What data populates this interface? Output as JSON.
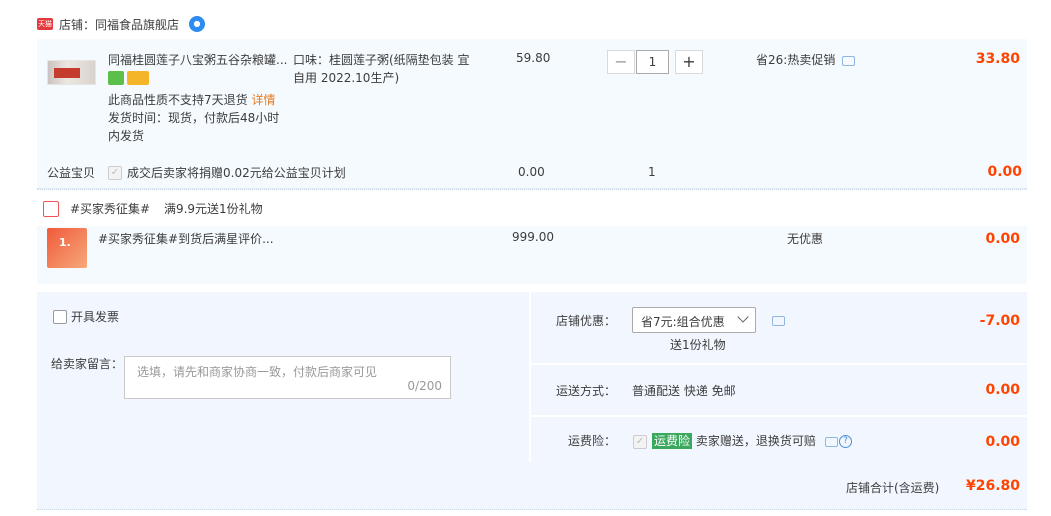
{
  "shop": {
    "tmall_text": "天猫",
    "label": "店铺：同福食品旗舰店",
    "ww_badge": "●"
  },
  "item1": {
    "title": "同福桂圆莲子八宝粥五谷杂粮罐...",
    "refund_note": "此商品性质不支持7天退货",
    "refund_link": "详情",
    "ship_line1": "发货时间：现货，付款后48小时",
    "ship_line2": "内发货",
    "spec_line1": "口味：桂圆莲子粥(纸隔垫包装 宜",
    "spec_line2": "自用 2022.10生产)",
    "price": "59.80",
    "qty": "1",
    "discount": "省26:热卖促销",
    "total": "33.80"
  },
  "charity": {
    "label": "公益宝贝",
    "text": "成交后卖家将捐赠0.02元给公益宝贝计划",
    "price": "0.00",
    "qty": "1",
    "total": "0.00"
  },
  "gift": {
    "tag": "#买家秀征集#",
    "promo": "满9.9元送1份礼物",
    "item_title": "#买家秀征集#到货后满星评价...",
    "item_thumb_text": "1.",
    "price": "999.00",
    "discount": "无优惠",
    "total": "0.00"
  },
  "invoice": {
    "label": "开具发票"
  },
  "message": {
    "label": "给卖家留言：",
    "placeholder": "选填，请先和商家协商一致，付款后商家可见",
    "count": "0/200"
  },
  "shop_discount": {
    "label": "店铺优惠：",
    "selected": "省7元:组合优惠",
    "sub": "送1份礼物",
    "total": "-7.00"
  },
  "shipping": {
    "label": "运送方式：",
    "value": "普通配送 快递 免邮",
    "total": "0.00"
  },
  "insurance": {
    "label": "运费险：",
    "tag": "运费险",
    "text": "卖家赠送，退换货可赔",
    "total": "0.00"
  },
  "summary": {
    "label": "店铺合计(含运费)",
    "value": "¥26.80"
  },
  "colors": {
    "accent": "#ff4400",
    "panel": "#f2f7ff",
    "link": "#e47b23",
    "green": "#3aa85d"
  },
  "icons": [
    "tmall-logo-icon",
    "wangwang-icon",
    "chat-icon",
    "gift-icon",
    "help-icon",
    "chevron-down-icon"
  ]
}
